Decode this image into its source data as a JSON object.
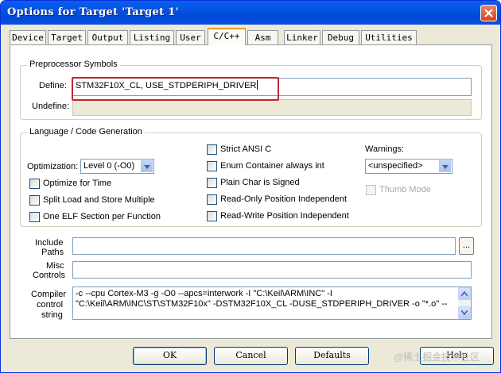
{
  "window": {
    "title": "Options for Target 'Target 1'"
  },
  "tabs": [
    {
      "label": "Device"
    },
    {
      "label": "Target"
    },
    {
      "label": "Output"
    },
    {
      "label": "Listing"
    },
    {
      "label": "User"
    },
    {
      "label": "C/C++"
    },
    {
      "label": "Asm"
    },
    {
      "label": "Linker"
    },
    {
      "label": "Debug"
    },
    {
      "label": "Utilities"
    }
  ],
  "active_tab": "C/C++",
  "preprocessor": {
    "group_label": "Preprocessor Symbols",
    "define_label": "Define:",
    "define_value": "STM32F10X_CL, USE_STDPERIPH_DRIVER",
    "undefine_label": "Undefine:",
    "undefine_value": ""
  },
  "language": {
    "group_label": "Language / Code Generation",
    "optimization_label": "Optimization:",
    "optimization_value": "Level 0 (-O0)",
    "checks": [
      {
        "label": "Optimize for Time",
        "checked": false,
        "enabled": true
      },
      {
        "label": "Split Load and Store Multiple",
        "checked": false,
        "enabled": true
      },
      {
        "label": "One ELF Section per Function",
        "checked": false,
        "enabled": true
      },
      {
        "label": "Strict ANSI C",
        "checked": false,
        "enabled": true
      },
      {
        "label": "Enum Container always int",
        "checked": false,
        "enabled": true
      },
      {
        "label": "Plain Char is Signed",
        "checked": false,
        "enabled": true
      },
      {
        "label": "Read-Only Position Independent",
        "checked": false,
        "enabled": true
      },
      {
        "label": "Read-Write Position Independent",
        "checked": false,
        "enabled": true
      },
      {
        "label": "Thumb Mode",
        "checked": false,
        "enabled": false
      }
    ],
    "warnings_label": "Warnings:",
    "warnings_value": "<unspecified>"
  },
  "paths": {
    "include_label_line1": "Include",
    "include_label_line2": "Paths",
    "include_value": "",
    "browse_label": "...",
    "misc_label_line1": "Misc",
    "misc_label_line2": "Controls",
    "misc_value": ""
  },
  "compiler": {
    "label_line1": "Compiler",
    "label_line2": "control",
    "label_line3": "string",
    "line1": "-c --cpu Cortex-M3 -g -O0 --apcs=interwork -I \"C:\\Keil\\ARM\\INC\" -I",
    "line2": "\"C:\\Keil\\ARM\\INC\\ST\\STM32F10x\" -DSTM32F10X_CL -DUSE_STDPERIPH_DRIVER -o \"*.o\" --"
  },
  "buttons": {
    "ok": "OK",
    "cancel": "Cancel",
    "defaults": "Defaults",
    "help": "Help"
  },
  "watermark": "@稀土掘金技术社区",
  "colors": {
    "titlebar": "#0553e4",
    "dialog_bg": "#ece9d8",
    "highlight_box": "#c0282c",
    "active_tab_accent": "#e89d2c"
  }
}
